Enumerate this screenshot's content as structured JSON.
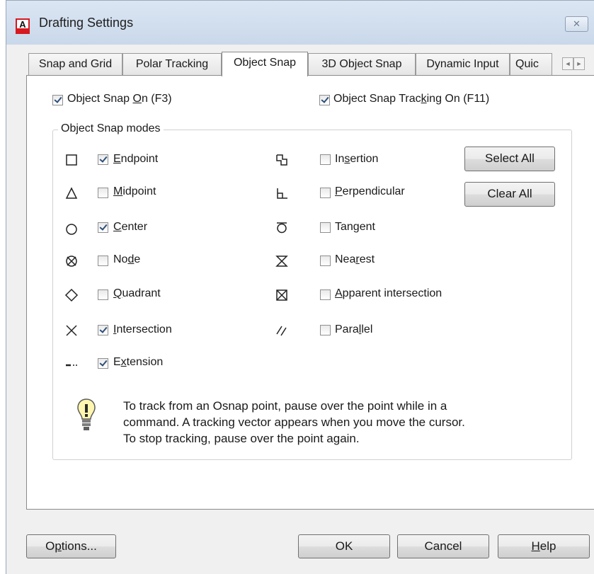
{
  "window": {
    "title": "Drafting Settings",
    "close_glyph": "✕",
    "app_icon": "autocad-logo-icon",
    "app_icon_letter": "A"
  },
  "tabs": [
    {
      "label": "Snap and Grid",
      "active": false
    },
    {
      "label": "Polar Tracking",
      "active": false
    },
    {
      "label": "Object Snap",
      "active": true
    },
    {
      "label": "3D Object Snap",
      "active": false
    },
    {
      "label": "Dynamic Input",
      "active": false
    },
    {
      "label": "Quic",
      "active": false
    }
  ],
  "tab_scroll": {
    "left": "◄",
    "right": "►"
  },
  "object_snap": {
    "snap_on": {
      "pre": "Object Snap ",
      "key": "O",
      "post": "n (F3)",
      "checked": true
    },
    "tracking_on": {
      "pre": "Object Snap Trac",
      "key": "k",
      "post": "ing On (F11)",
      "checked": true
    },
    "group_title": "Object Snap modes",
    "modes_left": [
      {
        "pre": "",
        "key": "E",
        "post": "ndpoint",
        "checked": true,
        "icon": "square-endpoint-icon"
      },
      {
        "pre": "",
        "key": "M",
        "post": "idpoint",
        "checked": false,
        "icon": "triangle-midpoint-icon"
      },
      {
        "pre": "",
        "key": "C",
        "post": "enter",
        "checked": true,
        "icon": "circle-center-icon"
      },
      {
        "pre": "No",
        "key": "d",
        "post": "e",
        "checked": false,
        "icon": "node-icon"
      },
      {
        "pre": "",
        "key": "Q",
        "post": "uadrant",
        "checked": false,
        "icon": "diamond-quadrant-icon"
      },
      {
        "pre": "",
        "key": "I",
        "post": "ntersection",
        "checked": true,
        "icon": "x-intersection-icon"
      },
      {
        "pre": "E",
        "key": "x",
        "post": "tension",
        "checked": true,
        "icon": "dashes-extension-icon"
      }
    ],
    "modes_right": [
      {
        "pre": "In",
        "key": "s",
        "post": "ertion",
        "checked": false,
        "icon": "insertion-icon"
      },
      {
        "pre": "",
        "key": "P",
        "post": "erpendicular",
        "checked": false,
        "icon": "perpendicular-icon"
      },
      {
        "pre": "Tan",
        "key": "g",
        "post": "ent",
        "checked": false,
        "icon": "tangent-icon"
      },
      {
        "pre": "Nea",
        "key": "r",
        "post": "est",
        "checked": false,
        "icon": "hourglass-nearest-icon"
      },
      {
        "pre": "",
        "key": "A",
        "post": "pparent intersection",
        "checked": false,
        "icon": "boxed-x-apparent-icon"
      },
      {
        "pre": "Para",
        "key": "l",
        "post": "lel",
        "checked": false,
        "icon": "slashes-parallel-icon"
      }
    ],
    "select_all": "Select All",
    "clear_all": "Clear All",
    "info_icon": "lightbulb-icon",
    "info_lines": [
      "To track from an Osnap point, pause over the point while in a",
      "command.  A tracking vector appears when you move the cursor.",
      "To stop tracking, pause over the point again."
    ]
  },
  "footer": {
    "options": {
      "pre": "O",
      "key": "p",
      "post": "tions..."
    },
    "ok": "OK",
    "cancel": "Cancel",
    "help": {
      "pre": "",
      "key": "H",
      "post": "elp"
    }
  },
  "colors": {
    "title_gradient_top": "#dbe6f3",
    "checkmark": "#2c4f7a",
    "logo_red": "#d71920"
  }
}
